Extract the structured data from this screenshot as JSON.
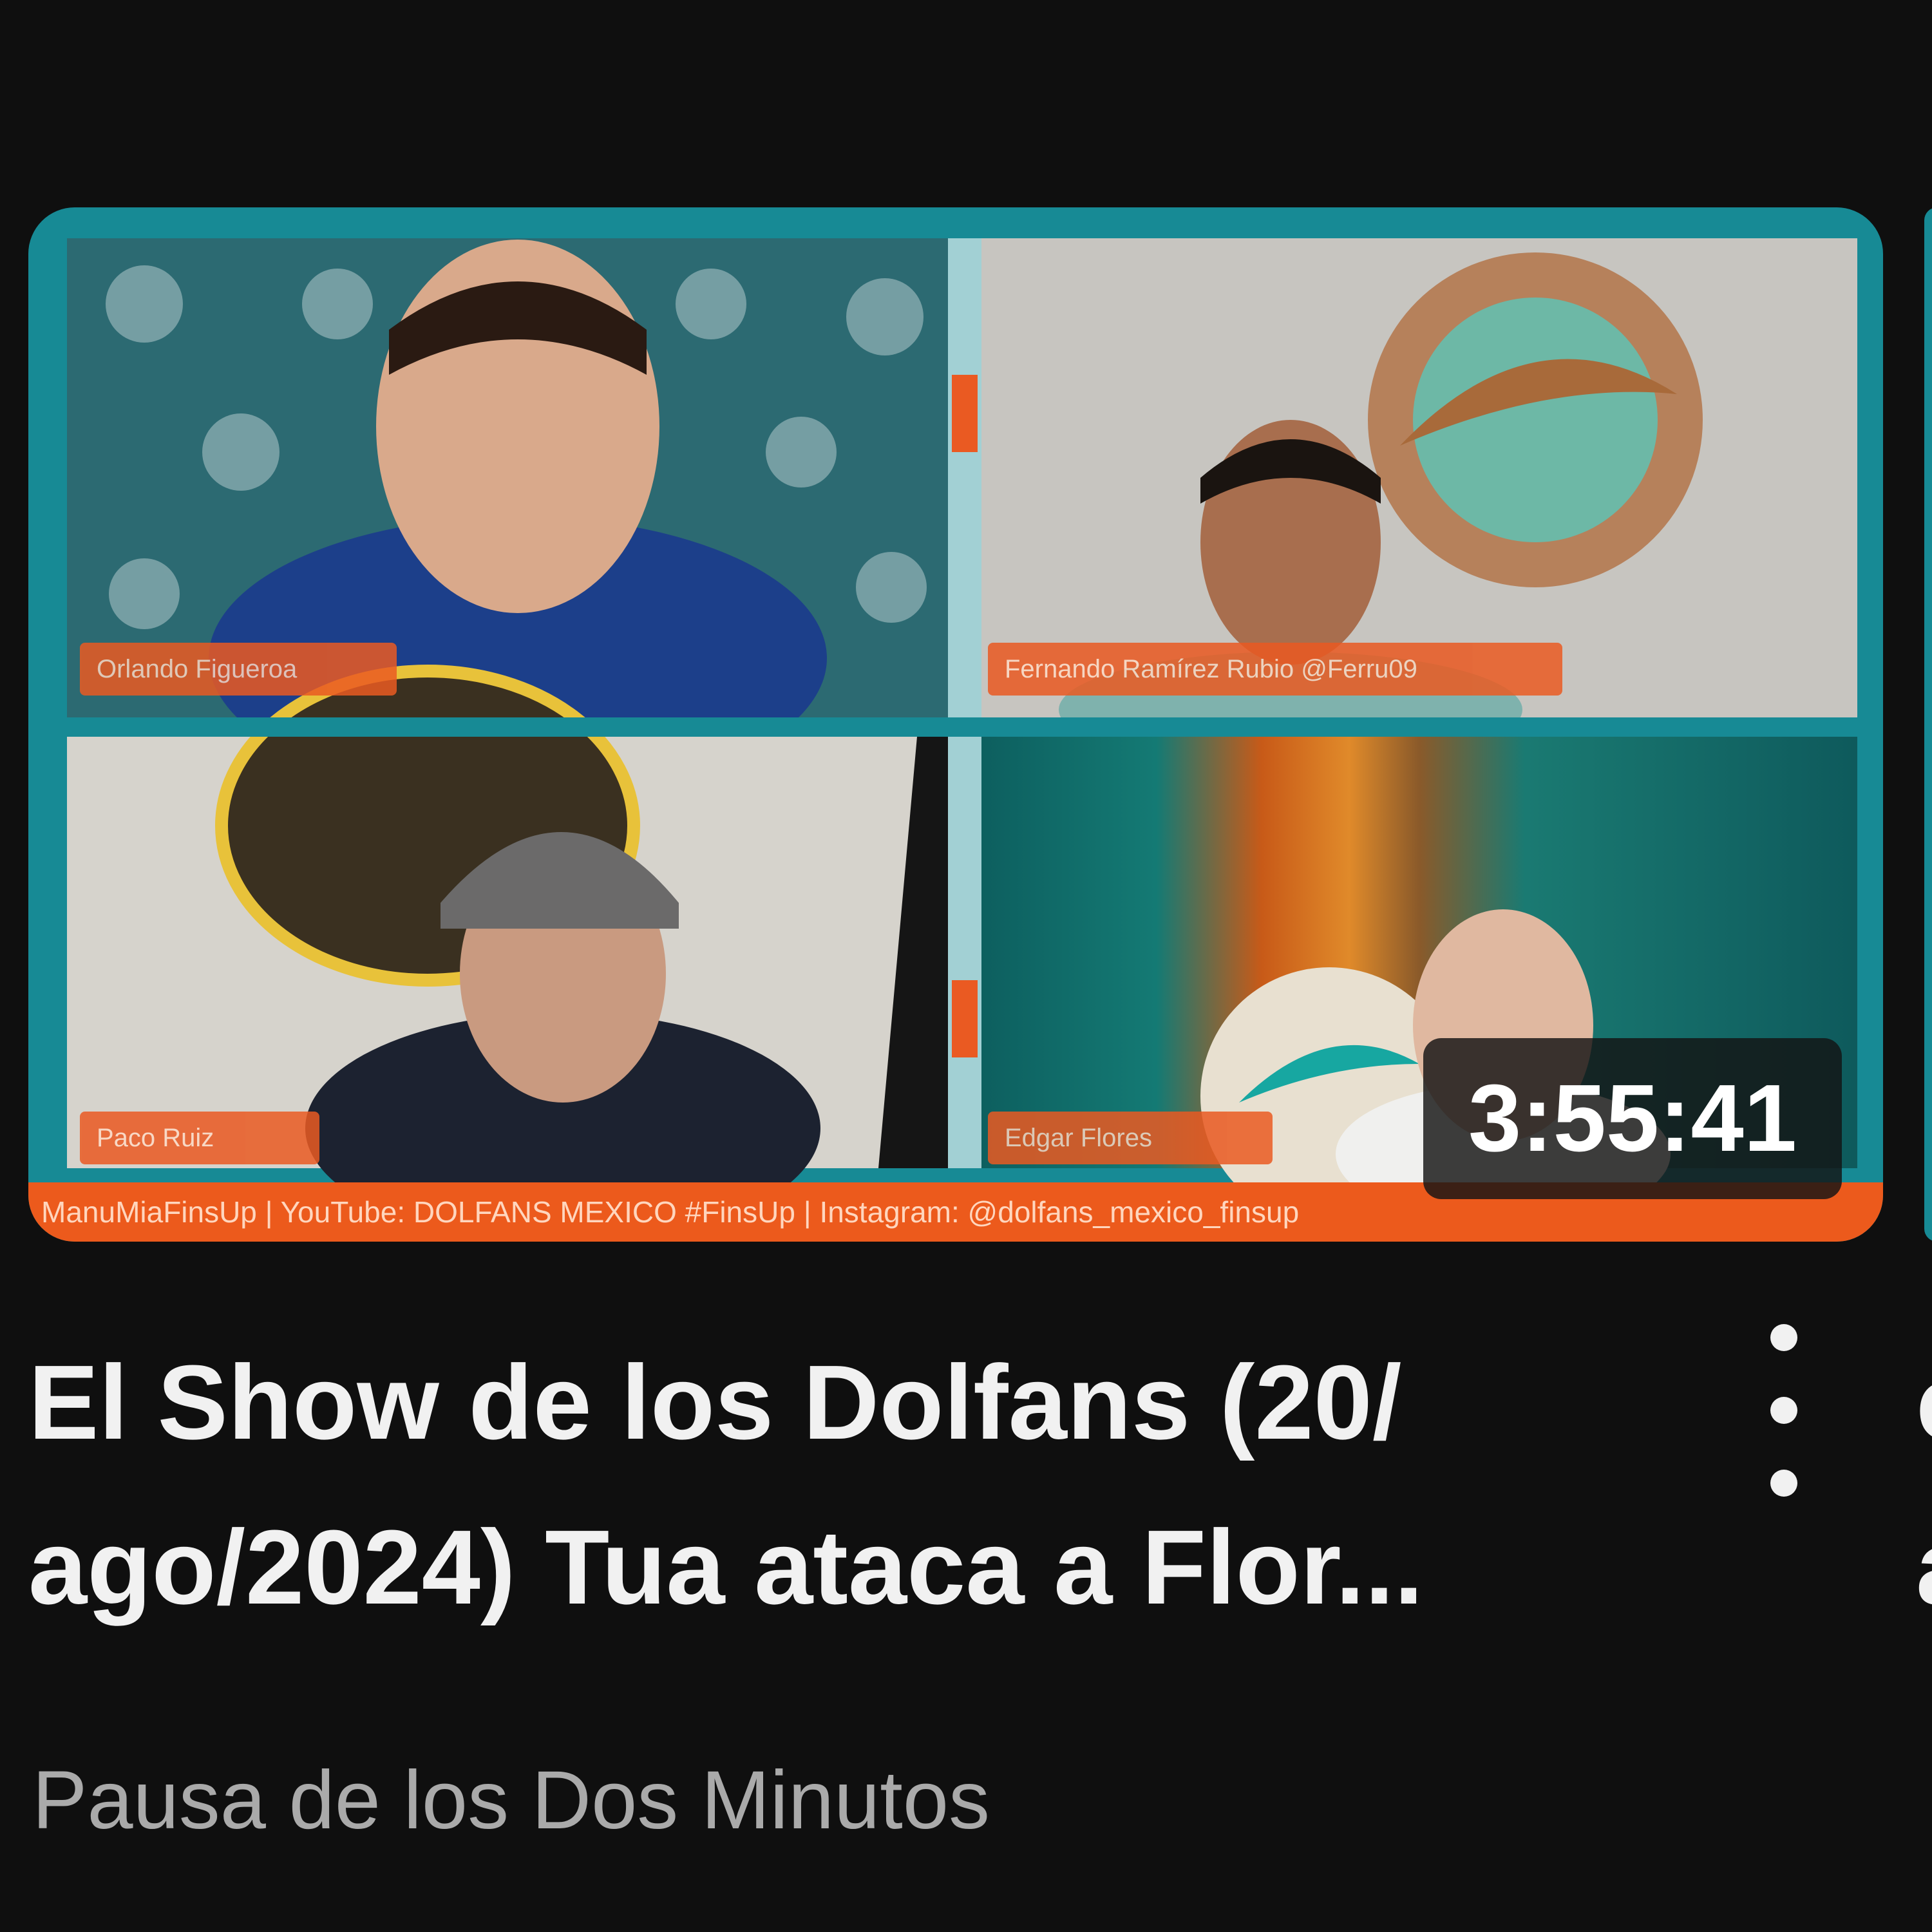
{
  "video": {
    "duration": "3:55:41",
    "title": "El Show de los Dolfans (20/ ago/2024) Tua ataca a Flor...",
    "channel": "Pausa de los Dos Minutos",
    "participants": [
      {
        "name": "Orlando Figueroa"
      },
      {
        "name": "Fernando Ramírez Rubio @Ferru09"
      },
      {
        "name": "Paco Ruiz"
      },
      {
        "name": "Edgar Flores"
      }
    ],
    "ticker": "ManuMiaFinsUp | YouTube: DOLFANS MEXICO #FinsUp | Instagram: @dolfans_mexico_finsup"
  },
  "next_video": {
    "title_fragment": "c a"
  },
  "colors": {
    "background": "#0f0f0f",
    "frame_teal": "#178a95",
    "label_orange": "#ea5a22",
    "title_text": "#f1f1f1",
    "channel_text": "#aaaaaa"
  },
  "icons": {
    "menu": "more-vert-icon"
  }
}
